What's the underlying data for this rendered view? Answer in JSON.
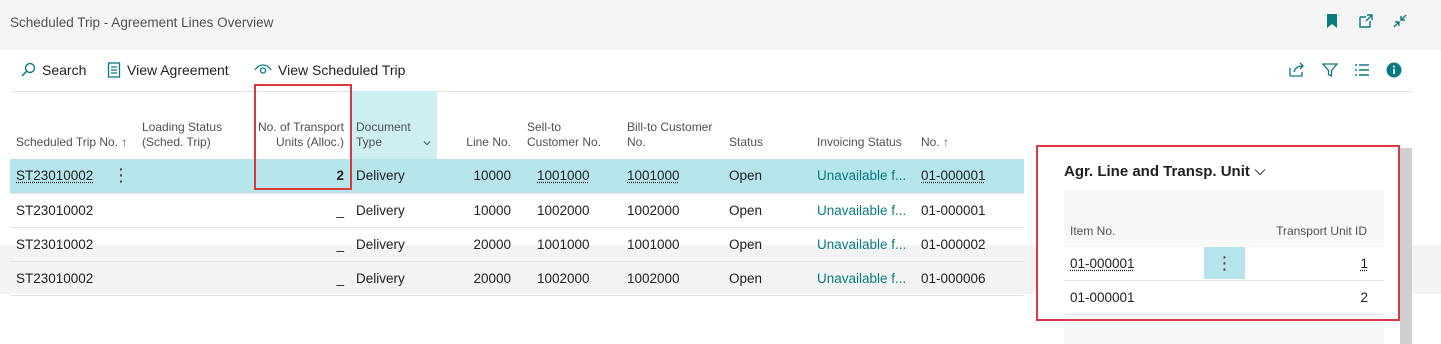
{
  "window": {
    "title": "Scheduled Trip - Agreement Lines Overview",
    "icons": [
      "bookmark-icon",
      "open-new-window-icon",
      "collapse-icon"
    ]
  },
  "actions": {
    "search_label": "Search",
    "view_agreement_label": "View Agreement",
    "view_scheduled_trip_label": "View Scheduled Trip",
    "right_icons": [
      "share-icon",
      "filter-icon",
      "list-icon",
      "info-icon"
    ]
  },
  "grid": {
    "columns": {
      "scheduled_trip_no": "Scheduled Trip No. ↑",
      "loading_status": "Loading Status (Sched. Trip)",
      "no_transport_units": "No. of Transport Units (Alloc.)",
      "document_type": "Document Type",
      "line_no": "Line No.",
      "sell_to": "Sell-to Customer No.",
      "bill_to": "Bill-to Customer No.",
      "status": "Status",
      "invoicing_status": "Invoicing Status",
      "no": "No. ↑"
    },
    "rows": [
      {
        "trip": "ST23010002",
        "units": "2",
        "doc_type": "Delivery",
        "line": "10000",
        "sell": "1001000",
        "bill": "1001000",
        "status": "Open",
        "invoicing": "Unavailable f...",
        "no": "01-000001"
      },
      {
        "trip": "ST23010002",
        "units": "_",
        "doc_type": "Delivery",
        "line": "10000",
        "sell": "1002000",
        "bill": "1002000",
        "status": "Open",
        "invoicing": "Unavailable f...",
        "no": "01-000001"
      },
      {
        "trip": "ST23010002",
        "units": "_",
        "doc_type": "Delivery",
        "line": "20000",
        "sell": "1001000",
        "bill": "1001000",
        "status": "Open",
        "invoicing": "Unavailable f...",
        "no": "01-000002"
      },
      {
        "trip": "ST23010002",
        "units": "_",
        "doc_type": "Delivery",
        "line": "20000",
        "sell": "1002000",
        "bill": "1002000",
        "status": "Open",
        "invoicing": "Unavailable f...",
        "no": "01-000006"
      }
    ]
  },
  "factbox": {
    "title": "Agr. Line and Transp. Unit",
    "col_item_no": "Item No.",
    "col_transport_unit_id": "Transport Unit ID",
    "rows": [
      {
        "item": "01-000001",
        "unit_id": "1"
      },
      {
        "item": "01-000001",
        "unit_id": "2"
      }
    ]
  },
  "colors": {
    "accent": "#0a7a82",
    "selected_row": "#b5e5ea",
    "callout": "#d9393f"
  }
}
